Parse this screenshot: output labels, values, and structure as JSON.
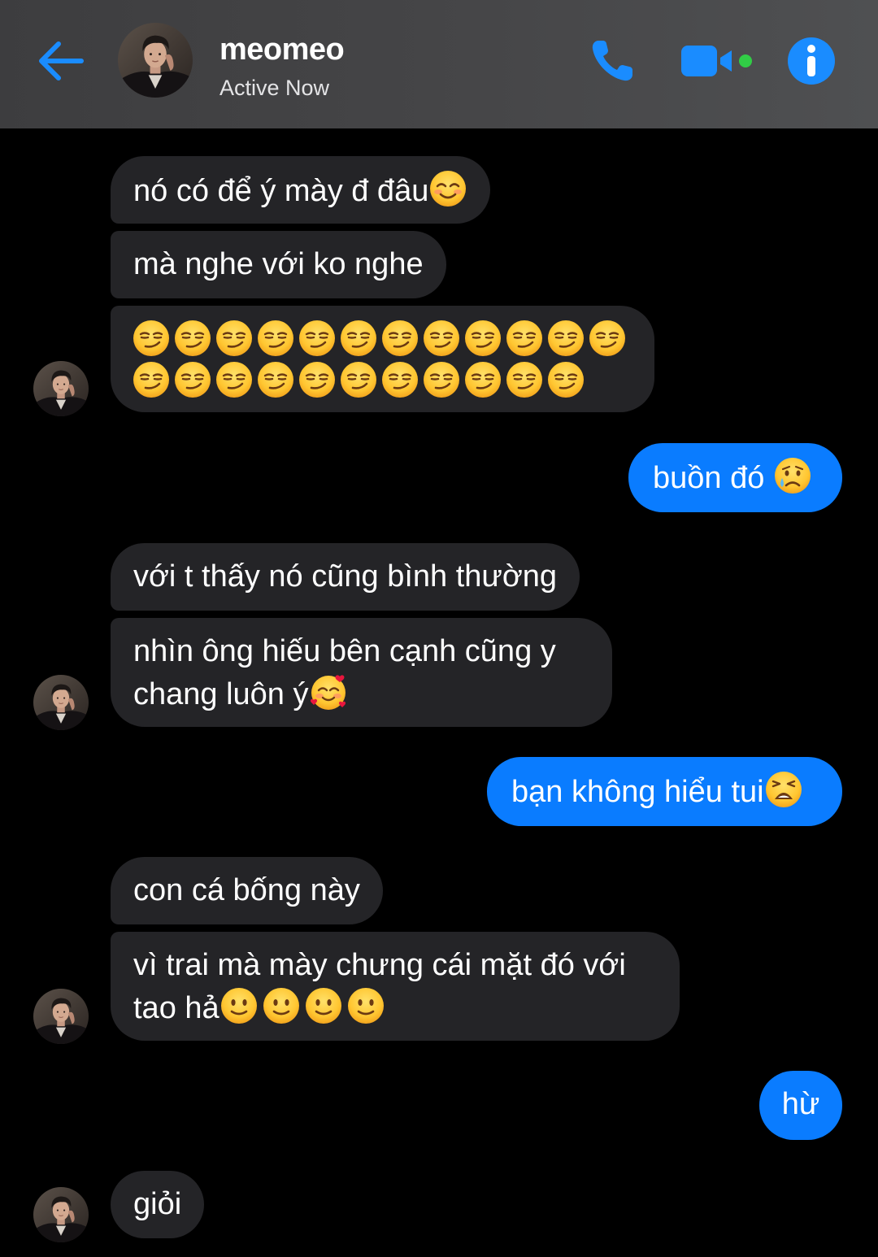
{
  "header": {
    "contact_name": "meomeo",
    "status": "Active Now",
    "icons": {
      "back": "arrow-left-icon",
      "call": "phone-icon",
      "video": "video-camera-icon",
      "info": "info-icon"
    },
    "accent_color": "#1a8cff",
    "online_dot_color": "#31cc46"
  },
  "conversation": {
    "messages": [
      {
        "from": "contact",
        "text": "nó có để ý mày đ đâu",
        "emoji": [
          "smiling-face-with-blush"
        ]
      },
      {
        "from": "contact",
        "text": "mà nghe với ko nghe"
      },
      {
        "from": "contact",
        "text": "",
        "emoji_count": 23,
        "emoji_name": "smirking-face"
      },
      {
        "from": "me",
        "text": "buồn đó ",
        "emoji": [
          "crying-face"
        ]
      },
      {
        "from": "contact",
        "text": "với t thấy nó cũng bình thường"
      },
      {
        "from": "contact",
        "line1": "nhìn ông hiếu bên cạnh cũng y",
        "line2": "chang luôn ý",
        "emoji": [
          "smiling-face-with-hearts"
        ]
      },
      {
        "from": "me",
        "text": "bạn không hiểu tui",
        "emoji": [
          "weary-face"
        ]
      },
      {
        "from": "contact",
        "text": "con cá bống này"
      },
      {
        "from": "contact",
        "line1": "vì trai mà mày chưng cái mặt đó với",
        "line2": "tao hả",
        "emoji": [
          "slightly-smiling-face",
          "slightly-smiling-face",
          "slightly-smiling-face",
          "slightly-smiling-face"
        ]
      },
      {
        "from": "me",
        "text": "hừ"
      },
      {
        "from": "contact",
        "text": "giỏi"
      }
    ]
  },
  "colors": {
    "incoming_bubble": "#242427",
    "outgoing_bubble": "#0a7cff",
    "background": "#000000"
  }
}
